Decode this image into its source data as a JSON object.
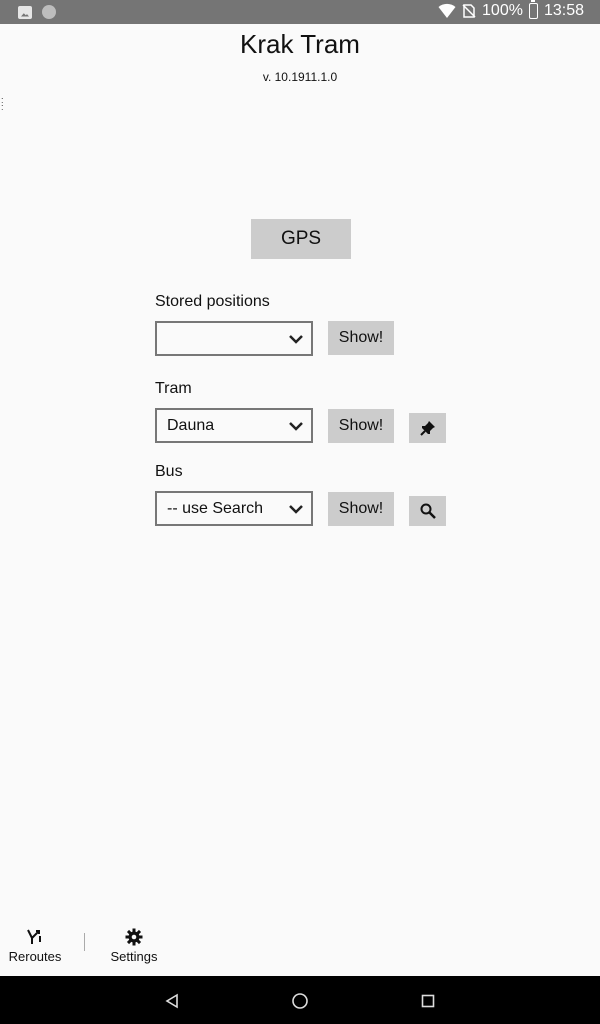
{
  "status_bar": {
    "battery": "100%",
    "time": "13:58",
    "icons": [
      "image-notification-icon",
      "circle-notification-icon",
      "wifi-icon",
      "no-sim-icon",
      "battery-icon"
    ]
  },
  "header": {
    "title": "Krak Tram",
    "version": "v. 10.1911.1.0"
  },
  "gps_button": {
    "label": "GPS"
  },
  "stored_positions": {
    "label": "Stored positions",
    "selected": "",
    "show_label": "Show!"
  },
  "tram": {
    "label": "Tram",
    "selected": "Dauna",
    "show_label": "Show!",
    "pin_icon": "pin-icon"
  },
  "bus": {
    "label": "Bus",
    "selected": "-- use Search",
    "show_label": "Show!",
    "search_icon": "search-icon"
  },
  "bottom_tabs": [
    {
      "label": "Reroutes",
      "icon": "reroutes-icon"
    },
    {
      "label": "Settings",
      "icon": "gear-icon"
    }
  ],
  "nav_bar": [
    "back-icon",
    "home-icon",
    "recents-icon"
  ],
  "colors": {
    "status_bar": "#757575",
    "background": "#fafafa",
    "button": "#cccccc",
    "nav_bar": "#000000"
  }
}
